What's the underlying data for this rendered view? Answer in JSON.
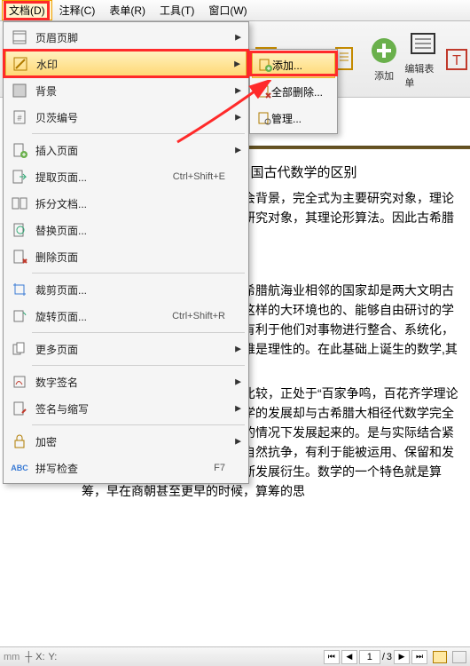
{
  "menubar": {
    "items": [
      "文档(D)",
      "注释(C)",
      "表单(R)",
      "工具(T)",
      "窗口(W)"
    ],
    "activeIndex": 0
  },
  "toolbar": {
    "buttons": [
      {
        "name": "add",
        "label": "添加",
        "icon": "plus-circle"
      },
      {
        "name": "edit-form",
        "label": "编辑表单",
        "icon": "form"
      },
      {
        "name": "text",
        "label": "",
        "icon": "textbox"
      }
    ]
  },
  "docMenu": {
    "items": [
      {
        "icon": "header-footer",
        "label": "页眉页脚",
        "sub": true
      },
      {
        "icon": "watermark",
        "label": "水印",
        "sub": true,
        "hov": true
      },
      {
        "icon": "background",
        "label": "背景",
        "sub": true
      },
      {
        "icon": "bates",
        "label": "贝茨编号",
        "sub": true
      },
      {
        "sep": true
      },
      {
        "icon": "insert-page",
        "label": "插入页面",
        "sub": true
      },
      {
        "icon": "extract",
        "label": "提取页面...",
        "shortcut": "Ctrl+Shift+E"
      },
      {
        "icon": "split",
        "label": "拆分文档..."
      },
      {
        "icon": "replace",
        "label": "替换页面..."
      },
      {
        "icon": "delete",
        "label": "删除页面"
      },
      {
        "sep": true
      },
      {
        "icon": "crop",
        "label": "裁剪页面..."
      },
      {
        "icon": "rotate",
        "label": "旋转页面...",
        "shortcut": "Ctrl+Shift+R"
      },
      {
        "sep": true
      },
      {
        "icon": "more",
        "label": "更多页面",
        "sub": true
      },
      {
        "sep": true
      },
      {
        "icon": "sign",
        "label": "数字签名",
        "sub": true
      },
      {
        "icon": "initials",
        "label": "签名与缩写",
        "sub": true
      },
      {
        "sep": true
      },
      {
        "icon": "lock",
        "label": "加密",
        "sub": true
      },
      {
        "icon": "spell",
        "label": "拼写检查",
        "shortcut": "F7"
      }
    ]
  },
  "watermarkSub": {
    "items": [
      {
        "icon": "add",
        "label": "添加...",
        "hov": true
      },
      {
        "icon": "delete-all",
        "label": "全部删除..."
      },
      {
        "sep": true
      },
      {
        "icon": "manage",
        "label": "管理..."
      }
    ]
  },
  "document": {
    "title": "腊数学与中国古代数学的区别",
    "p1": "式数学具有截然不同的社会背景，完全式为主要研究对象，理论形式表现为推数量关系为主要研究对象，其理论形算法。因此古希腊数学与中国古代数",
    "p2": "优良的自然条件，因此古希腊航海业相邻的国家却是两大文明古国：埃及化传统中吸取精华。这样的大环境也的、能够自由研讨的学术氛围。由于的广泛交流，更有利于他们对事物进行整合、系统化，便形成了古希腊的哲学，其思维是理性的。在此基础上诞生的数学,其体系也就绎。",
    "p3": "与古希腊同时代的中国相比较，正处于“百家争鸣，百花齐学理论也发展到了相当的高度，但数学的发展却与古希腊大相径代数学完全是由自己，在没有与外界交流的情况下发展起来的。是与实际结合紧密的，因为早期的人类要同大自然抗争，有利于能被运用、保留和发展，数学正是这样的环境下不断发展衍生。数学的一个特色就是算筹，早在商朝甚至更早的时候，算筹的思"
  },
  "status": {
    "x": "X:",
    "y": "Y:",
    "page": "1",
    "total": "3",
    "sep": "/"
  }
}
